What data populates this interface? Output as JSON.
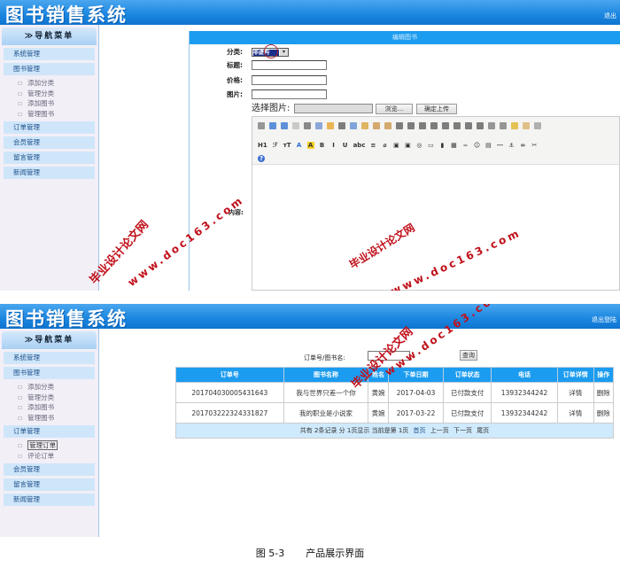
{
  "app_title": "图书销售系统",
  "logout_short": "退出",
  "logout": "退出登陆",
  "nav": {
    "header": "≫导航菜单",
    "groups": [
      "系统管理",
      "图书管理",
      "订单管理",
      "会员管理",
      "留言管理",
      "新闻管理"
    ],
    "book_subitems": [
      "添加分类",
      "管理分类",
      "添加图书",
      "管理图书"
    ],
    "order_subitems": [
      "管理订单",
      "评论订单"
    ]
  },
  "edit_form": {
    "title": "编辑图书",
    "category_label": "分类:",
    "category_value": "非虚构",
    "title_label": "标题:",
    "price_label": "价格:",
    "image_label": "图片:",
    "choose_image_label": "选择图片:",
    "browse_button": "浏览...",
    "upload_button": "确定上传",
    "content_label": "内容:"
  },
  "orders": {
    "search_label": "订单号/图书名:",
    "search_value": "",
    "search_button": "查询",
    "columns": [
      "订单号",
      "图书名称",
      "姓名",
      "下单日期",
      "订单状态",
      "电话",
      "订单详情",
      "操作"
    ],
    "rows": [
      [
        "201704030005431643",
        "我与世界只差一个你",
        "黄婉",
        "2017-04-03",
        "已付款支付",
        "13932344242",
        "详情",
        "删除"
      ],
      [
        "201703222324331827",
        "我的职业是小说家",
        "黄婉",
        "2017-03-22",
        "已付款支付",
        "13932344242",
        "详情",
        "删除"
      ]
    ],
    "footer": "共有 2条记录   分 1页显示   当前是第 1页",
    "pager": [
      "首页",
      "上一页",
      "下一页",
      "尾页"
    ]
  },
  "watermark": {
    "cn": "毕业设计论文网",
    "url": "www.doc163.com"
  },
  "caption": {
    "figure": "图 5-3",
    "text": "产品展示界面"
  },
  "colors": {
    "header_blue": "#1a86e0",
    "table_header": "#1b9cf0",
    "watermark_red": "#c0101a"
  }
}
